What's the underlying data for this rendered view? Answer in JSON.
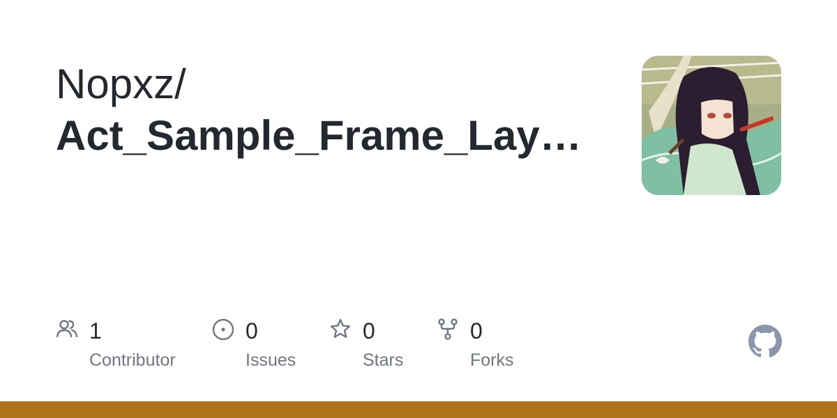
{
  "repo": {
    "owner": "Nopxz/",
    "name": "Act_Sample_Frame_Layo…"
  },
  "stats": [
    {
      "icon": "contributors-icon",
      "count": "1",
      "label": "Contributor"
    },
    {
      "icon": "issues-icon",
      "count": "0",
      "label": "Issues"
    },
    {
      "icon": "star-icon",
      "count": "0",
      "label": "Stars"
    },
    {
      "icon": "fork-icon",
      "count": "0",
      "label": "Forks"
    }
  ],
  "brand": {
    "logo": "github-logo-icon",
    "logo_color": "#8b96ac"
  },
  "colors": {
    "text_primary": "#24292f",
    "text_secondary": "#6e7781",
    "icon": "#6e7781",
    "language_bar": "#b07219"
  }
}
